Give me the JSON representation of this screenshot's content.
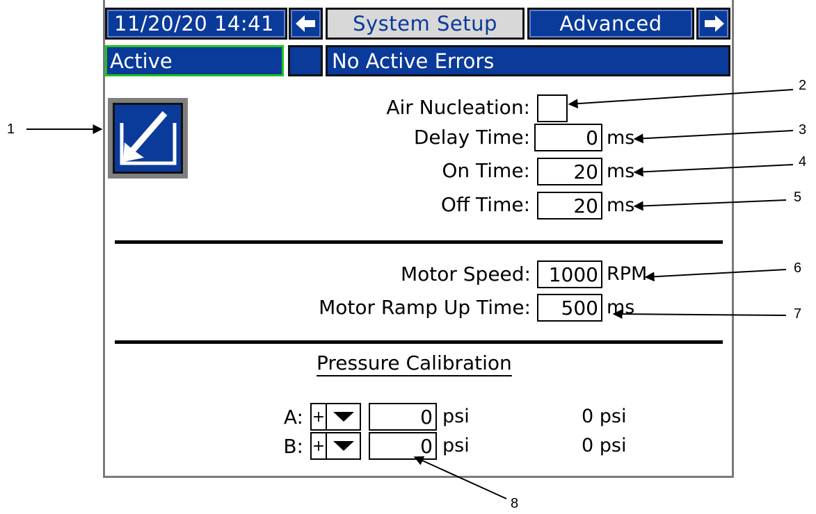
{
  "header": {
    "datetime": "11/20/20 14:41",
    "tab_current": "System Setup",
    "tab_next": "Advanced"
  },
  "status": {
    "mode": "Active",
    "errors": "No Active Errors"
  },
  "nucleation": {
    "air_label": "Air Nucleation:",
    "air_checked": false,
    "delay_label": "Delay Time:",
    "delay_value": "0",
    "delay_unit": "ms",
    "on_label": "On Time:",
    "on_value": "20",
    "on_unit": "ms",
    "off_label": "Off Time:",
    "off_value": "20",
    "off_unit": "ms"
  },
  "motor": {
    "speed_label": "Motor Speed:",
    "speed_value": "1000",
    "speed_unit": "RPM",
    "ramp_label": "Motor Ramp Up Time:",
    "ramp_value": "500",
    "ramp_unit": "ms"
  },
  "calibration": {
    "title": "Pressure Calibration",
    "rows": [
      {
        "label": "A:",
        "sign": "+",
        "value": "0",
        "unit": "psi",
        "reading": "0 psi"
      },
      {
        "label": "B:",
        "sign": "+",
        "value": "0",
        "unit": "psi",
        "reading": "0 psi"
      }
    ]
  },
  "callouts": [
    "1",
    "2",
    "3",
    "4",
    "5",
    "6",
    "7",
    "8"
  ],
  "colors": {
    "nav_blue": "#0a3a9a",
    "active_border": "#1ec31e",
    "tab_gray": "#d8d8d8"
  }
}
